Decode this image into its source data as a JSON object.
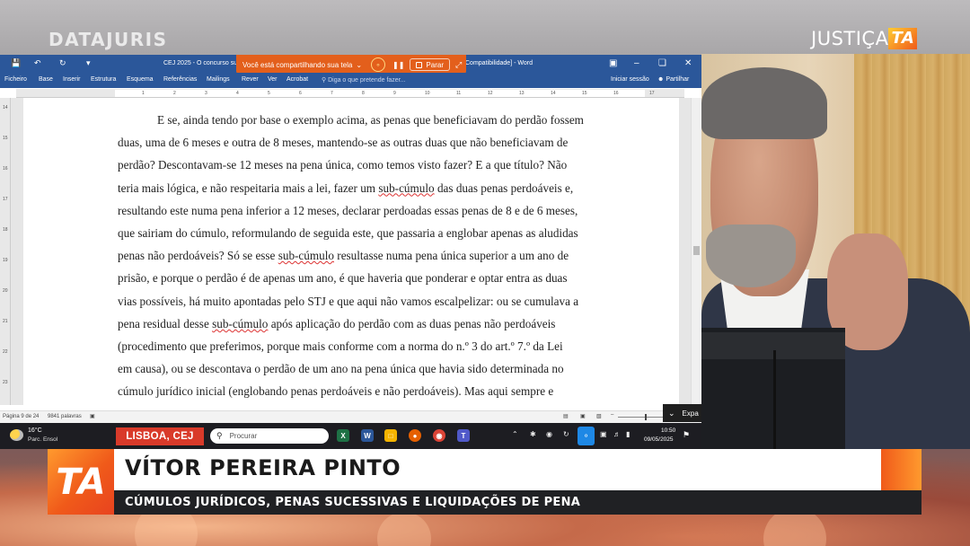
{
  "broadcast": {
    "logo_left": "DATAJURIS",
    "logo_right_text": "JUSTIÇA",
    "logo_right_mark": "TA",
    "location": "LISBOA, CEJ",
    "lower_third_logo": "TA",
    "speaker_name": "VÍTOR PEREIRA PINTO",
    "topic": "CÚMULOS JURÍDICOS, PENAS SUCESSIVAS E LIQUIDAÇÕES DE PENA",
    "accent_color": "#f05a1a"
  },
  "word": {
    "doc_title_left": "CEJ 2025 - O concurso su",
    "doc_title_right": "Compatibilidade] - Word",
    "share_bar": {
      "text": "Você está compartilhando sua tela",
      "stop_label": "Parar"
    },
    "ribbon_tabs": [
      "Ficheiro",
      "Base",
      "Inserir",
      "Estrutura",
      "Esquema",
      "Referências",
      "Mailings",
      "Rever",
      "Ver",
      "Acrobat"
    ],
    "tell_me": "Diga o que pretende fazer...",
    "sign_in": "Iniciar sessão",
    "share": "Partilhar",
    "ruler_numbers": [
      "1",
      "2",
      "3",
      "4",
      "5",
      "6",
      "7",
      "8",
      "9",
      "10",
      "11",
      "12",
      "13",
      "14",
      "15",
      "16",
      "17"
    ],
    "vruler_numbers": [
      "14",
      "15",
      "16",
      "17",
      "18",
      "19",
      "20",
      "21",
      "22",
      "23"
    ],
    "paragraph": {
      "l1": "E se, ainda tendo por base o exemplo acima, as penas que beneficiavam do perdão fossem",
      "l2": "duas, uma de 6 meses e outra de 8 meses, mantendo-se as outras duas que não beneficiavam de",
      "l3": "perdão? Descontavam-se 12 meses na pena única, como temos visto fazer? E a que título? Não",
      "l4a": "teria mais lógica, e não respeitaria mais a lei, fazer um ",
      "l4u": "sub-cúmulo",
      "l4b": " das duas penas perdoáveis e,",
      "l5": "resultando este numa pena inferior a 12 meses, declarar perdoadas essas penas de 8 e de 6 meses,",
      "l6": "que sairiam do cúmulo, reformulando de seguida este, que passaria a englobar apenas as aludidas",
      "l7a": "penas não perdoáveis? Só se esse ",
      "l7u": "sub-cúmulo",
      "l7b": " resultasse numa pena única superior a um ano de",
      "l8": "prisão, e porque o perdão é de apenas um ano, é que haveria que ponderar e optar entra as duas",
      "l9": "vias possíveis, há muito apontadas pelo STJ e que aqui não vamos escalpelizar: ou se cumulava a",
      "l10a": "pena residual desse ",
      "l10u": "sub-cúmulo",
      "l10b": " após aplicação do perdão com as duas penas não perdoáveis",
      "l11": "(procedimento que preferimos, porque mais conforme com a norma do n.º 3 do art.º 7.º da Lei",
      "l12": "em causa), ou se descontava o perdão de um ano na pena única que havia sido determinada no",
      "l13": "cúmulo jurídico inicial (englobando penas perdoáveis e não perdoáveis). Mas aqui sempre e"
    },
    "status": {
      "page": "Página 9 de 24",
      "words": "9841 palavras"
    },
    "expand_label": "Expa"
  },
  "taskbar": {
    "temperature": "16°C",
    "condition": "Parc. Ensol",
    "search_placeholder": "Procurar",
    "time": "10:50",
    "date": "09/05/2025"
  }
}
